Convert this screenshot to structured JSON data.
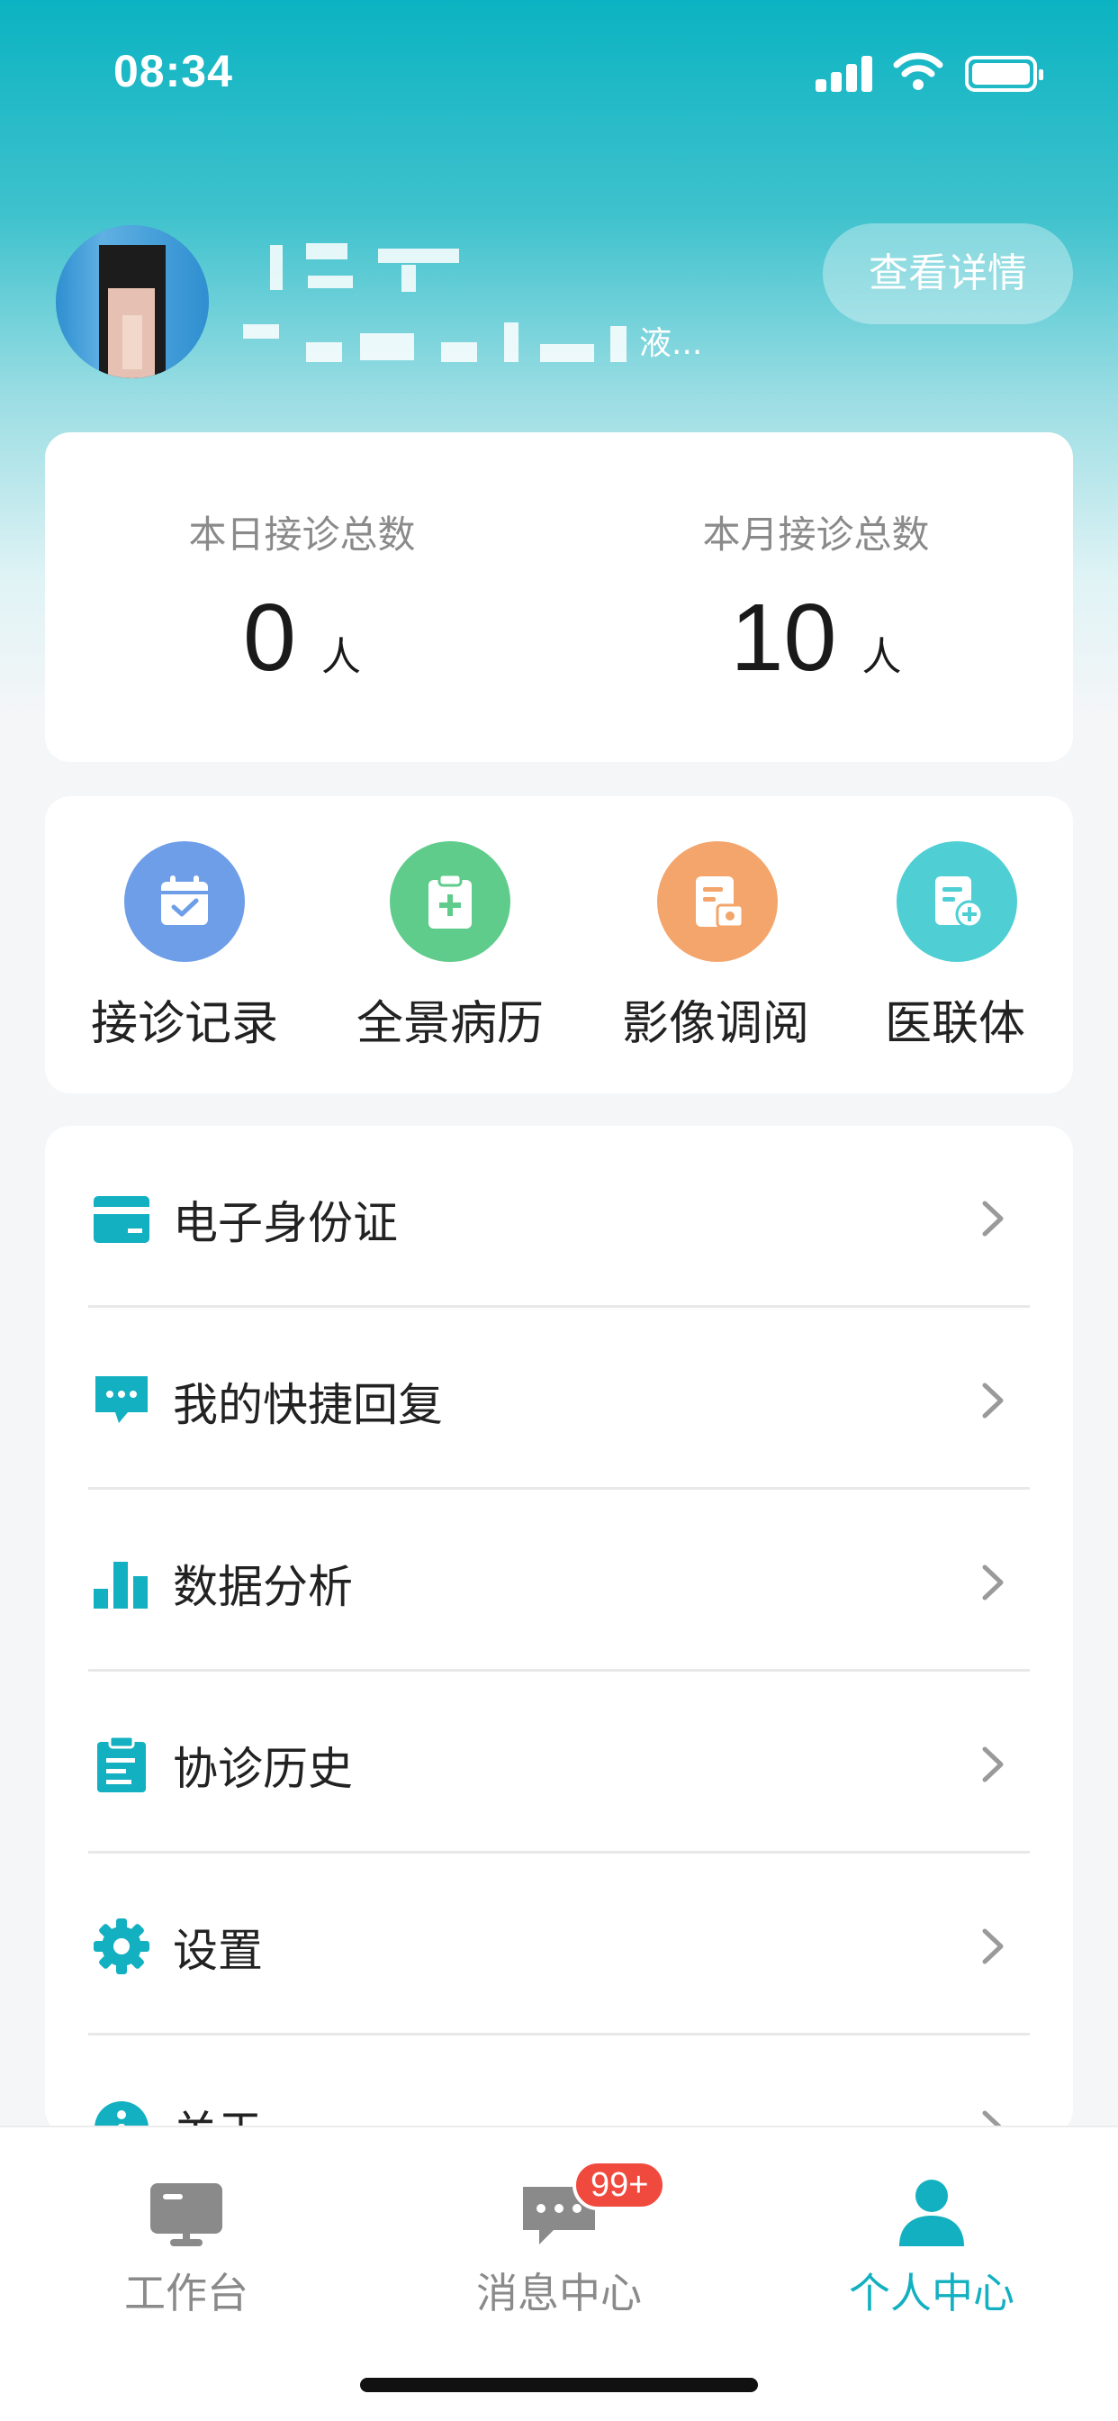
{
  "status_bar": {
    "time": "08:34"
  },
  "profile": {
    "name_partial": "液...",
    "detail_button": "查看详情"
  },
  "stats": [
    {
      "label": "本日接诊总数",
      "value": "0",
      "unit": "人"
    },
    {
      "label": "本月接诊总数",
      "value": "10",
      "unit": "人"
    }
  ],
  "quick_actions": [
    {
      "label": "接诊记录",
      "icon": "calendar-check-icon",
      "color": "#6f9ee8"
    },
    {
      "label": "全景病历",
      "icon": "medical-clipboard-icon",
      "color": "#5fcc8c"
    },
    {
      "label": "影像调阅",
      "icon": "image-document-icon",
      "color": "#f3a56b"
    },
    {
      "label": "医联体",
      "icon": "medical-document-icon",
      "color": "#4fcfd4"
    }
  ],
  "menu": [
    {
      "label": "电子身份证",
      "icon": "id-card-icon"
    },
    {
      "label": "我的快捷回复",
      "icon": "chat-bubble-icon"
    },
    {
      "label": "数据分析",
      "icon": "bar-chart-icon"
    },
    {
      "label": "协诊历史",
      "icon": "clipboard-list-icon"
    },
    {
      "label": "设置",
      "icon": "gear-icon"
    },
    {
      "label": "关于",
      "icon": "info-icon"
    }
  ],
  "tabs": [
    {
      "label": "工作台",
      "icon": "monitor-icon",
      "active": false
    },
    {
      "label": "消息中心",
      "icon": "message-icon",
      "active": false,
      "badge": "99+"
    },
    {
      "label": "个人中心",
      "icon": "person-icon",
      "active": true
    }
  ],
  "colors": {
    "accent": "#12b0c0",
    "badge": "#f04a3e"
  }
}
